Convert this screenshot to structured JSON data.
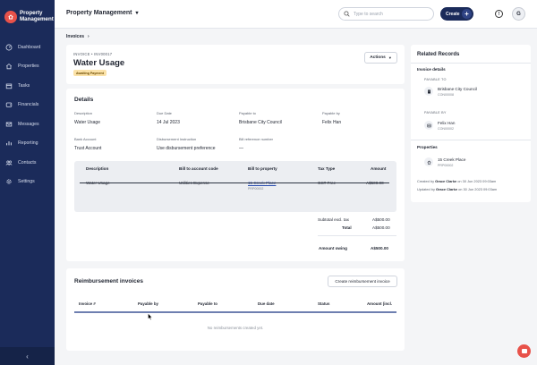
{
  "brand": {
    "name_line1": "Property",
    "name_line2": "Management"
  },
  "sidebar": {
    "items": [
      {
        "label": "Dashboard",
        "icon": "dashboard-icon"
      },
      {
        "label": "Properties",
        "icon": "house-icon"
      },
      {
        "label": "Tasks",
        "icon": "calendar-icon"
      },
      {
        "label": "Financials",
        "icon": "wallet-icon"
      },
      {
        "label": "Messages",
        "icon": "mail-icon"
      },
      {
        "label": "Reporting",
        "icon": "chart-icon"
      },
      {
        "label": "Contacts",
        "icon": "contacts-icon"
      },
      {
        "label": "Settings",
        "icon": "gear-icon"
      }
    ],
    "collapse_glyph": "‹"
  },
  "topbar": {
    "app_name": "Property Management",
    "search_placeholder": "Type to search",
    "create_label": "Create",
    "avatar_initial": "G",
    "help_glyph": "!"
  },
  "breadcrumb": {
    "item": "Invoices"
  },
  "invoice": {
    "type": "INVOICE",
    "number": "INV00017",
    "title": "Water Usage",
    "status": "Awaiting Payment",
    "actions_label": "Actions"
  },
  "details": {
    "title": "Details",
    "fields": [
      {
        "label": "Description",
        "value": "Water Usage"
      },
      {
        "label": "Due Date",
        "value": "14 Jul 2023"
      },
      {
        "label": "Payable to",
        "value": "Brisbane City Council"
      },
      {
        "label": "Payable by",
        "value": "Felix Han"
      },
      {
        "label": "Bank Account",
        "value": "Trust Account"
      },
      {
        "label": "Disbursement Instruction",
        "value": "Use disbursement preference"
      },
      {
        "label": "Bill reference number",
        "value": "—"
      }
    ]
  },
  "lines": {
    "headers": [
      "Description",
      "Bill to account code",
      "Bill to property",
      "Tax Type",
      "Amount"
    ],
    "row": {
      "description": "Water Usage",
      "account_code": "Utilities Expense",
      "property": "15 Creek Place",
      "property_code": "PRP00002",
      "tax_type": "GST Free",
      "amount": "A$500.00"
    }
  },
  "totals": {
    "subtotal_label": "Subtotal excl. tax",
    "subtotal_value": "A$500.00",
    "total_label": "Total",
    "total_value": "A$500.00",
    "owing_label": "Amount owing",
    "owing_value": "A$500.00"
  },
  "reimbursement": {
    "title": "Reimbursement invoices",
    "create_label": "Create reimbursement invoice",
    "headers": [
      "Invoice #",
      "Payable by",
      "Payable to",
      "Due date",
      "Status",
      "Amount (incl."
    ],
    "empty": "No reimbursements created yet."
  },
  "related": {
    "title": "Related Records",
    "invoice_details_label": "Invoice details",
    "payable_to_label": "PAYABLE TO",
    "payable_to_name": "Brisbane City Council",
    "payable_to_code": "CON00008",
    "payable_by_label": "PAYABLE BY",
    "payable_by_name": "Felix Han",
    "payable_by_code": "CON00002",
    "properties_label": "Properties",
    "property_name": "15 Creek Place",
    "property_code": "PRP00002"
  },
  "audit": {
    "created_prefix": "Created by",
    "created_by": "Grace Clarke",
    "created_on": "on 30 Jun 2023 09:03am",
    "updated_prefix": "Updated by",
    "updated_by": "Grace Clarke",
    "updated_on": "on 30 Jun 2023 09:03am"
  },
  "colors": {
    "sidebar": "#1b2b5a",
    "accent": "#e8524a",
    "badge": "#fbe2a8",
    "link": "#2a4db0"
  }
}
